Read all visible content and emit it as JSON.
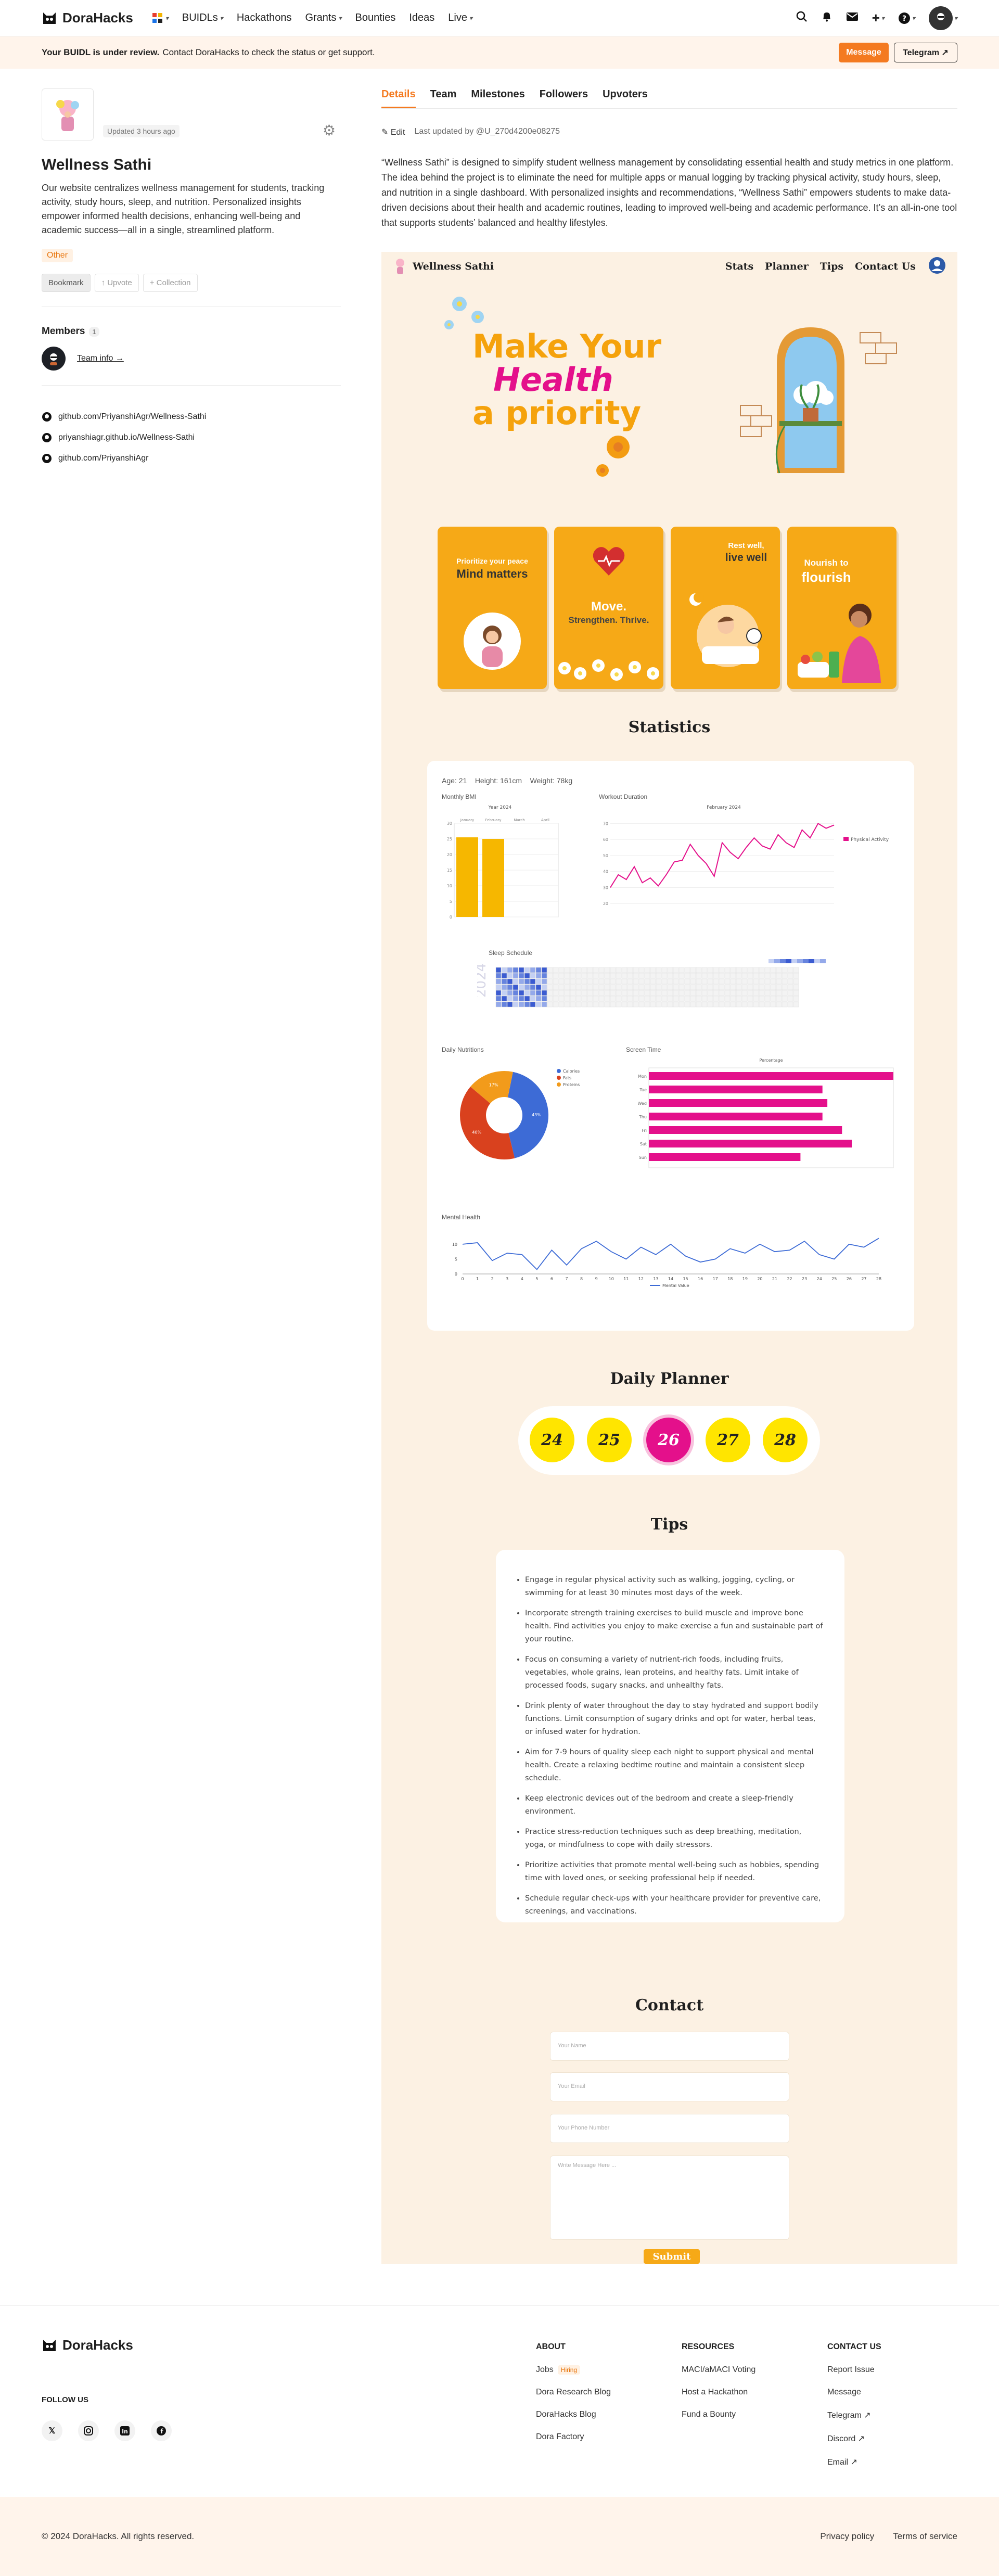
{
  "nav": {
    "brand": "DoraHacks",
    "menu": [
      "BUIDLs",
      "Hackathons",
      "Grants",
      "Bounties",
      "Ideas",
      "Live"
    ]
  },
  "banner": {
    "bold": "Your BUIDL is under review.",
    "text": "Contact DoraHacks to check the status or get support.",
    "message_label": "Message",
    "telegram_label": "Telegram ↗"
  },
  "sidebar": {
    "updated": "Updated 3 hours ago",
    "title": "Wellness Sathi",
    "description": "Our website centralizes wellness management for students, tracking activity, study hours, sleep, and nutrition. Personalized insights empower informed health decisions, enhancing well-being and academic success—all in a single, streamlined platform.",
    "tag": "Other",
    "bookmark": "Bookmark",
    "upvote": "↑ Upvote",
    "collection": "+ Collection",
    "members_label": "Members",
    "members_count": "1",
    "team_info": "Team info →",
    "links": [
      "github.com/PriyanshiAgr/Wellness-Sathi",
      "priyanshiagr.github.io/Wellness-Sathi",
      "github.com/PriyanshiAgr"
    ]
  },
  "tabs": [
    "Details",
    "Team",
    "Milestones",
    "Followers",
    "Upvoters"
  ],
  "edit": {
    "label": "Edit",
    "updated_by": "Last updated by @U_270d4200e08275"
  },
  "about": "“Wellness Sathi” is designed to simplify student wellness management by consolidating essential health and study metrics in one platform. The idea behind the project is to eliminate the need for multiple apps or manual logging by tracking physical activity, study hours, sleep, and nutrition in a single dashboard. With personalized insights and recommendations, “Wellness Sathi” empowers students to make data-driven decisions about their health and academic routines, leading to improved well-being and academic performance. It’s an all-in-one tool that supports students’ balanced and healthy lifestyles.",
  "site": {
    "brand": "Wellness Sathi",
    "nav": [
      "Stats",
      "Planner",
      "Tips",
      "Contact Us"
    ],
    "hero": {
      "l1": "Make Your",
      "l2": "Health",
      "l3": "a priority"
    },
    "cards": [
      {
        "small": "Prioritize your peace",
        "big": "Mind matters"
      },
      {
        "small": "Move.",
        "big": "Strengthen. Thrive."
      },
      {
        "small": "Rest well,",
        "big": "live well"
      },
      {
        "small": "Nourish to",
        "big": "flourish"
      }
    ],
    "stats_title": "Statistics",
    "profile": "Age: 21    Height: 161cm    Weight: 78kg",
    "planner_title": "Daily Planner",
    "planner_days": [
      "24",
      "25",
      "26",
      "27",
      "28"
    ],
    "tips_title": "Tips",
    "tips": [
      "Engage in regular physical activity such as walking, jogging, cycling, or swimming for at least 30 minutes most days of the week.",
      "Incorporate strength training exercises to build muscle and improve bone health. Find activities you enjoy to make exercise a fun and sustainable part of your routine.",
      "Focus on consuming a variety of nutrient-rich foods, including fruits, vegetables, whole grains, lean proteins, and healthy fats. Limit intake of processed foods, sugary snacks, and unhealthy fats.",
      "Drink plenty of water throughout the day to stay hydrated and support bodily functions. Limit consumption of sugary drinks and opt for water, herbal teas, or infused water for hydration.",
      "Aim for 7-9 hours of quality sleep each night to support physical and mental health. Create a relaxing bedtime routine and maintain a consistent sleep schedule.",
      "Keep electronic devices out of the bedroom and create a sleep-friendly environment.",
      "Practice stress-reduction techniques such as deep breathing, meditation, yoga, or mindfulness to cope with daily stressors.",
      "Prioritize activities that promote mental well-being such as hobbies, spending time with loved ones, or seeking professional help if needed.",
      "Schedule regular check-ups with your healthcare provider for preventive care, screenings, and vaccinations."
    ],
    "contact_title": "Contact",
    "form": {
      "name": "Your Name",
      "email": "Your Email",
      "phone": "Your Phone Number",
      "message": "Write Message Here ...",
      "submit": "Submit"
    }
  },
  "chart_data": [
    {
      "type": "bar",
      "title": "Monthly BMI",
      "subtitle": "Year 2024",
      "categories": [
        "January",
        "February",
        "March",
        "April"
      ],
      "values": [
        25.5,
        25,
        0,
        0
      ],
      "ylim": [
        0,
        30
      ]
    },
    {
      "type": "line",
      "title": "Workout Duration",
      "subtitle": "February 2024",
      "series": [
        {
          "name": "Physical Activity",
          "values": [
            30,
            38,
            35,
            43,
            33,
            36,
            31,
            38,
            46,
            47,
            57,
            50,
            45,
            37,
            58,
            52,
            48,
            55,
            61,
            56,
            54,
            63,
            58,
            55,
            66,
            61,
            70,
            67,
            69
          ]
        }
      ],
      "ylim": [
        10,
        75
      ]
    },
    {
      "type": "heatmap",
      "title": "Sleep Schedule",
      "year": "2024"
    },
    {
      "type": "pie",
      "title": "Daily Nutritions",
      "categories": [
        "Calories",
        "Fats",
        "Proteins"
      ],
      "values": [
        43,
        40,
        17
      ],
      "colors": [
        "#3d6bd6",
        "#d9411e",
        "#f29b1b"
      ]
    },
    {
      "type": "bar",
      "title": "Screen Time",
      "xlabel": "Percentage",
      "categories": [
        "Mon",
        "Tue",
        "Wed",
        "Thu",
        "Fri",
        "Sat",
        "Sun"
      ],
      "values": [
        100,
        71,
        73,
        71,
        79,
        83,
        62
      ],
      "xlim": [
        0,
        100
      ]
    },
    {
      "type": "line",
      "title": "Mental Health",
      "series": [
        {
          "name": "Mental Value",
          "values": [
            10,
            10.5,
            4.5,
            7,
            6.5,
            1.5,
            8,
            3,
            8.5,
            11,
            7.5,
            5,
            9,
            6.5,
            10,
            6,
            4,
            5,
            8.5,
            7,
            10,
            7.5,
            8,
            11,
            6.5,
            5,
            10,
            9,
            12
          ]
        }
      ],
      "ylim": [
        0,
        14
      ]
    }
  ],
  "footer": {
    "brand": "DoraHacks",
    "follow": "FOLLOW US",
    "about_h": "ABOUT",
    "about": [
      "Jobs",
      "Dora Research Blog",
      "DoraHacks Blog",
      "Dora Factory"
    ],
    "hiring": "Hiring",
    "resources_h": "RESOURCES",
    "resources": [
      "MACI/aMACI Voting",
      "Host a Hackathon",
      "Fund a Bounty"
    ],
    "contact_h": "CONTACT US",
    "contact": [
      "Report Issue",
      "Message",
      "Telegram ↗",
      "Discord ↗",
      "Email ↗"
    ],
    "copyright": "© 2024 DoraHacks. All rights reserved.",
    "privacy": "Privacy policy",
    "terms": "Terms of service"
  }
}
